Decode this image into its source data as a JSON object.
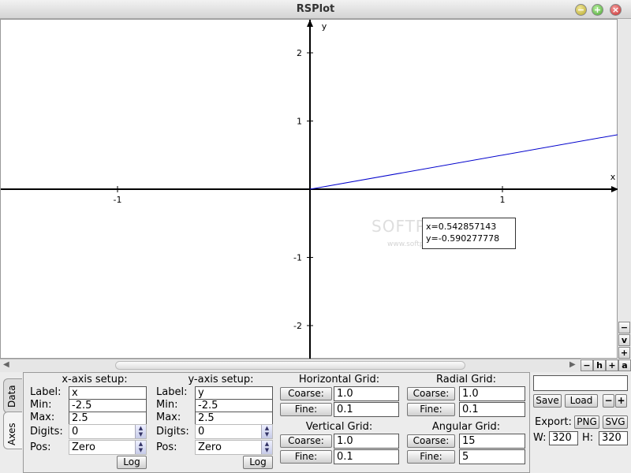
{
  "window": {
    "title": "RSPlot"
  },
  "plot": {
    "x_axis_label": "x",
    "y_axis_label": "y",
    "x_ticks": [
      {
        "v": -1,
        "label": "-1"
      },
      {
        "v": 1,
        "label": "1"
      }
    ],
    "y_ticks": [
      {
        "v": 2,
        "label": "2"
      },
      {
        "v": 1,
        "label": "1"
      },
      {
        "v": -1,
        "label": "-1"
      },
      {
        "v": -2,
        "label": "-2"
      }
    ],
    "line_color": "#0000cc",
    "tooltip": {
      "x": "x=0.542857143",
      "y": "y=-0.590277778"
    },
    "watermark": "SOFTPEDIA",
    "watermark_sub": "www.softpedia.com"
  },
  "vscroll_buttons": [
    "−",
    "v",
    "+"
  ],
  "hscroll_buttons": [
    "−",
    "h",
    "+",
    "a"
  ],
  "tabs": {
    "data": "Data",
    "axes": "Axes"
  },
  "x_axis": {
    "header": "x-axis setup:",
    "label_caption": "Label:",
    "label": "x",
    "min_caption": "Min:",
    "min": "-2.5",
    "max_caption": "Max:",
    "max": "2.5",
    "digits_caption": "Digits:",
    "digits": "0",
    "pos_caption": "Pos:",
    "pos": "Zero",
    "log_button": "Log"
  },
  "y_axis": {
    "header": "y-axis setup:",
    "label_caption": "Label:",
    "label": "y",
    "min_caption": "Min:",
    "min": "-2.5",
    "max_caption": "Max:",
    "max": "2.5",
    "digits_caption": "Digits:",
    "digits": "0",
    "pos_caption": "Pos:",
    "pos": "Zero",
    "log_button": "Log"
  },
  "horizontal_grid": {
    "header": "Horizontal Grid:",
    "coarse_button": "Coarse:",
    "coarse": "1.0",
    "fine_button": "Fine:",
    "fine": "0.1"
  },
  "vertical_grid": {
    "header": "Vertical Grid:",
    "coarse_button": "Coarse:",
    "coarse": "1.0",
    "fine_button": "Fine:",
    "fine": "0.1"
  },
  "radial_grid": {
    "header": "Radial Grid:",
    "coarse_button": "Coarse:",
    "coarse": "1.0",
    "fine_button": "Fine:",
    "fine": "0.1"
  },
  "angular_grid": {
    "header": "Angular Grid:",
    "coarse_button": "Coarse:",
    "coarse": "15",
    "fine_button": "Fine:",
    "fine": "5"
  },
  "file": {
    "name": "",
    "save_button": "Save",
    "load_button": "Load",
    "minus": "−",
    "plus": "+"
  },
  "export": {
    "caption": "Export:",
    "png_button": "PNG",
    "svg_button": "SVG",
    "w_caption": "W:",
    "w": "320",
    "h_caption": "H:",
    "h": "320"
  }
}
